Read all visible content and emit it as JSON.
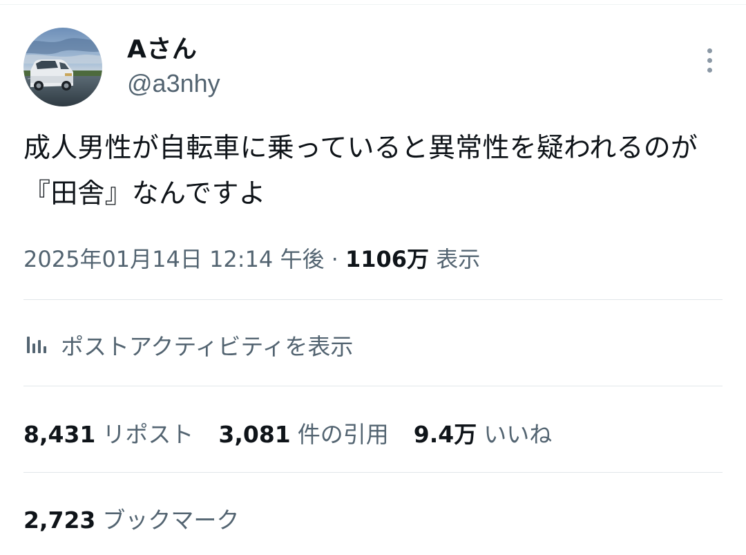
{
  "author": {
    "display_name": "Aさん",
    "handle": "@a3nhy",
    "avatar_icon": "avatar-photo-car"
  },
  "more_icon": "more-vertical-icon",
  "tweet": {
    "text": "成人男性が自転車に乗っていると異常性を疑われるのが『田舎』なんですよ"
  },
  "meta": {
    "date": "2025年01月14日",
    "time": "12:14 午後",
    "separator": "·",
    "views_count": "1106万",
    "views_label": "表示"
  },
  "activity": {
    "icon": "analytics-bars-icon",
    "label": "ポストアクティビティを表示"
  },
  "stats": {
    "reposts_count": "8,431",
    "reposts_label": "リポスト",
    "quotes_count": "3,081",
    "quotes_label": "件の引用",
    "likes_count": "9.4万",
    "likes_label": "いいね",
    "bookmarks_count": "2,723",
    "bookmarks_label": "ブックマーク"
  },
  "colors": {
    "text_primary": "#0f1419",
    "text_secondary": "#536471",
    "divider": "#e1e6e9",
    "background": "#ffffff"
  }
}
